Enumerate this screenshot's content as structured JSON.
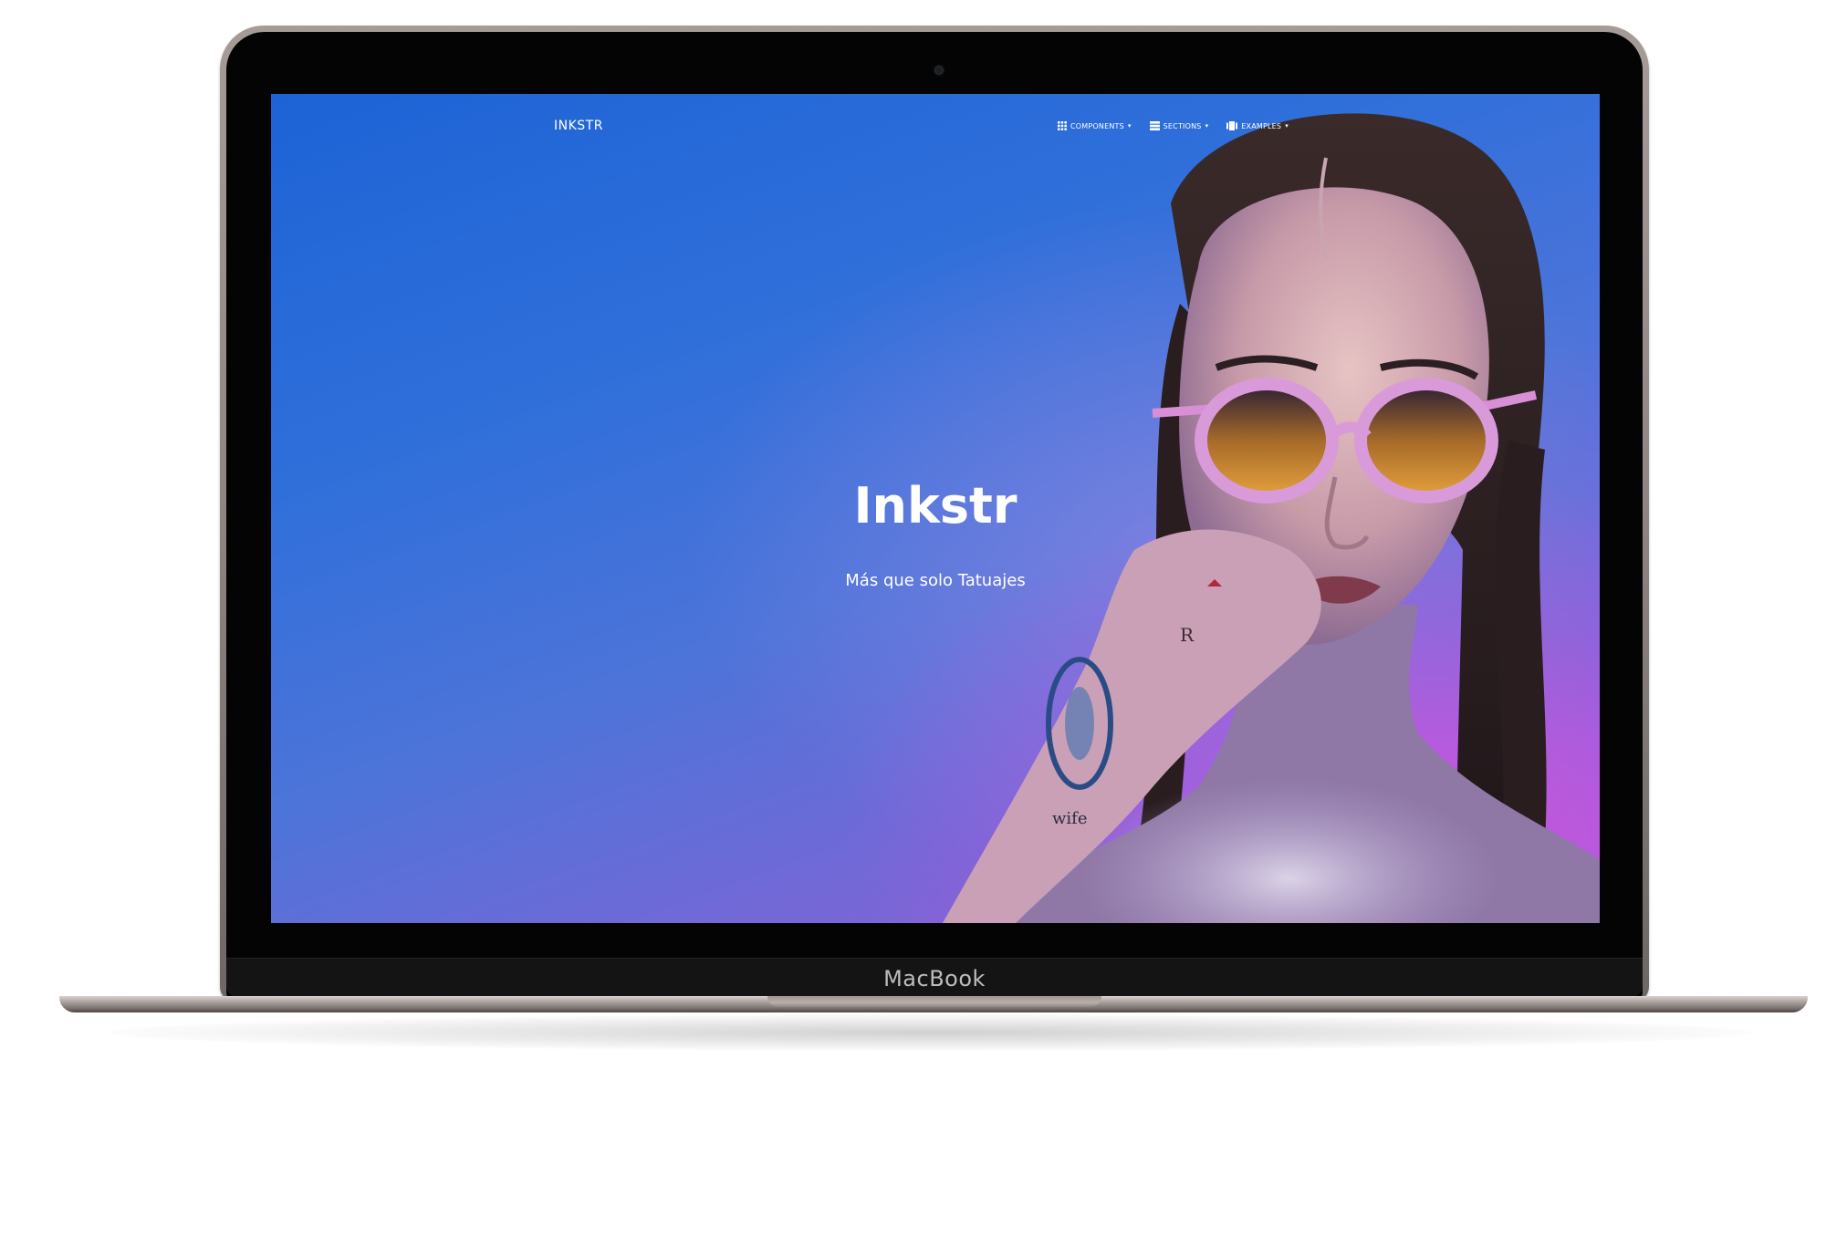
{
  "device": {
    "brand_label": "MacBook"
  },
  "navbar": {
    "brand": "INKSTR",
    "menu": [
      {
        "label": "COMPONENTS",
        "icon": "grid-icon"
      },
      {
        "label": "SECTIONS",
        "icon": "sections-icon"
      },
      {
        "label": "EXAMPLES",
        "icon": "examples-icon"
      }
    ]
  },
  "hero": {
    "title": "Inkstr",
    "subtitle": "Más que solo Tatuajes"
  },
  "colors": {
    "hero_gradient_start": "#1d63d6",
    "hero_gradient_end": "#d652e0",
    "text": "#ffffff"
  }
}
